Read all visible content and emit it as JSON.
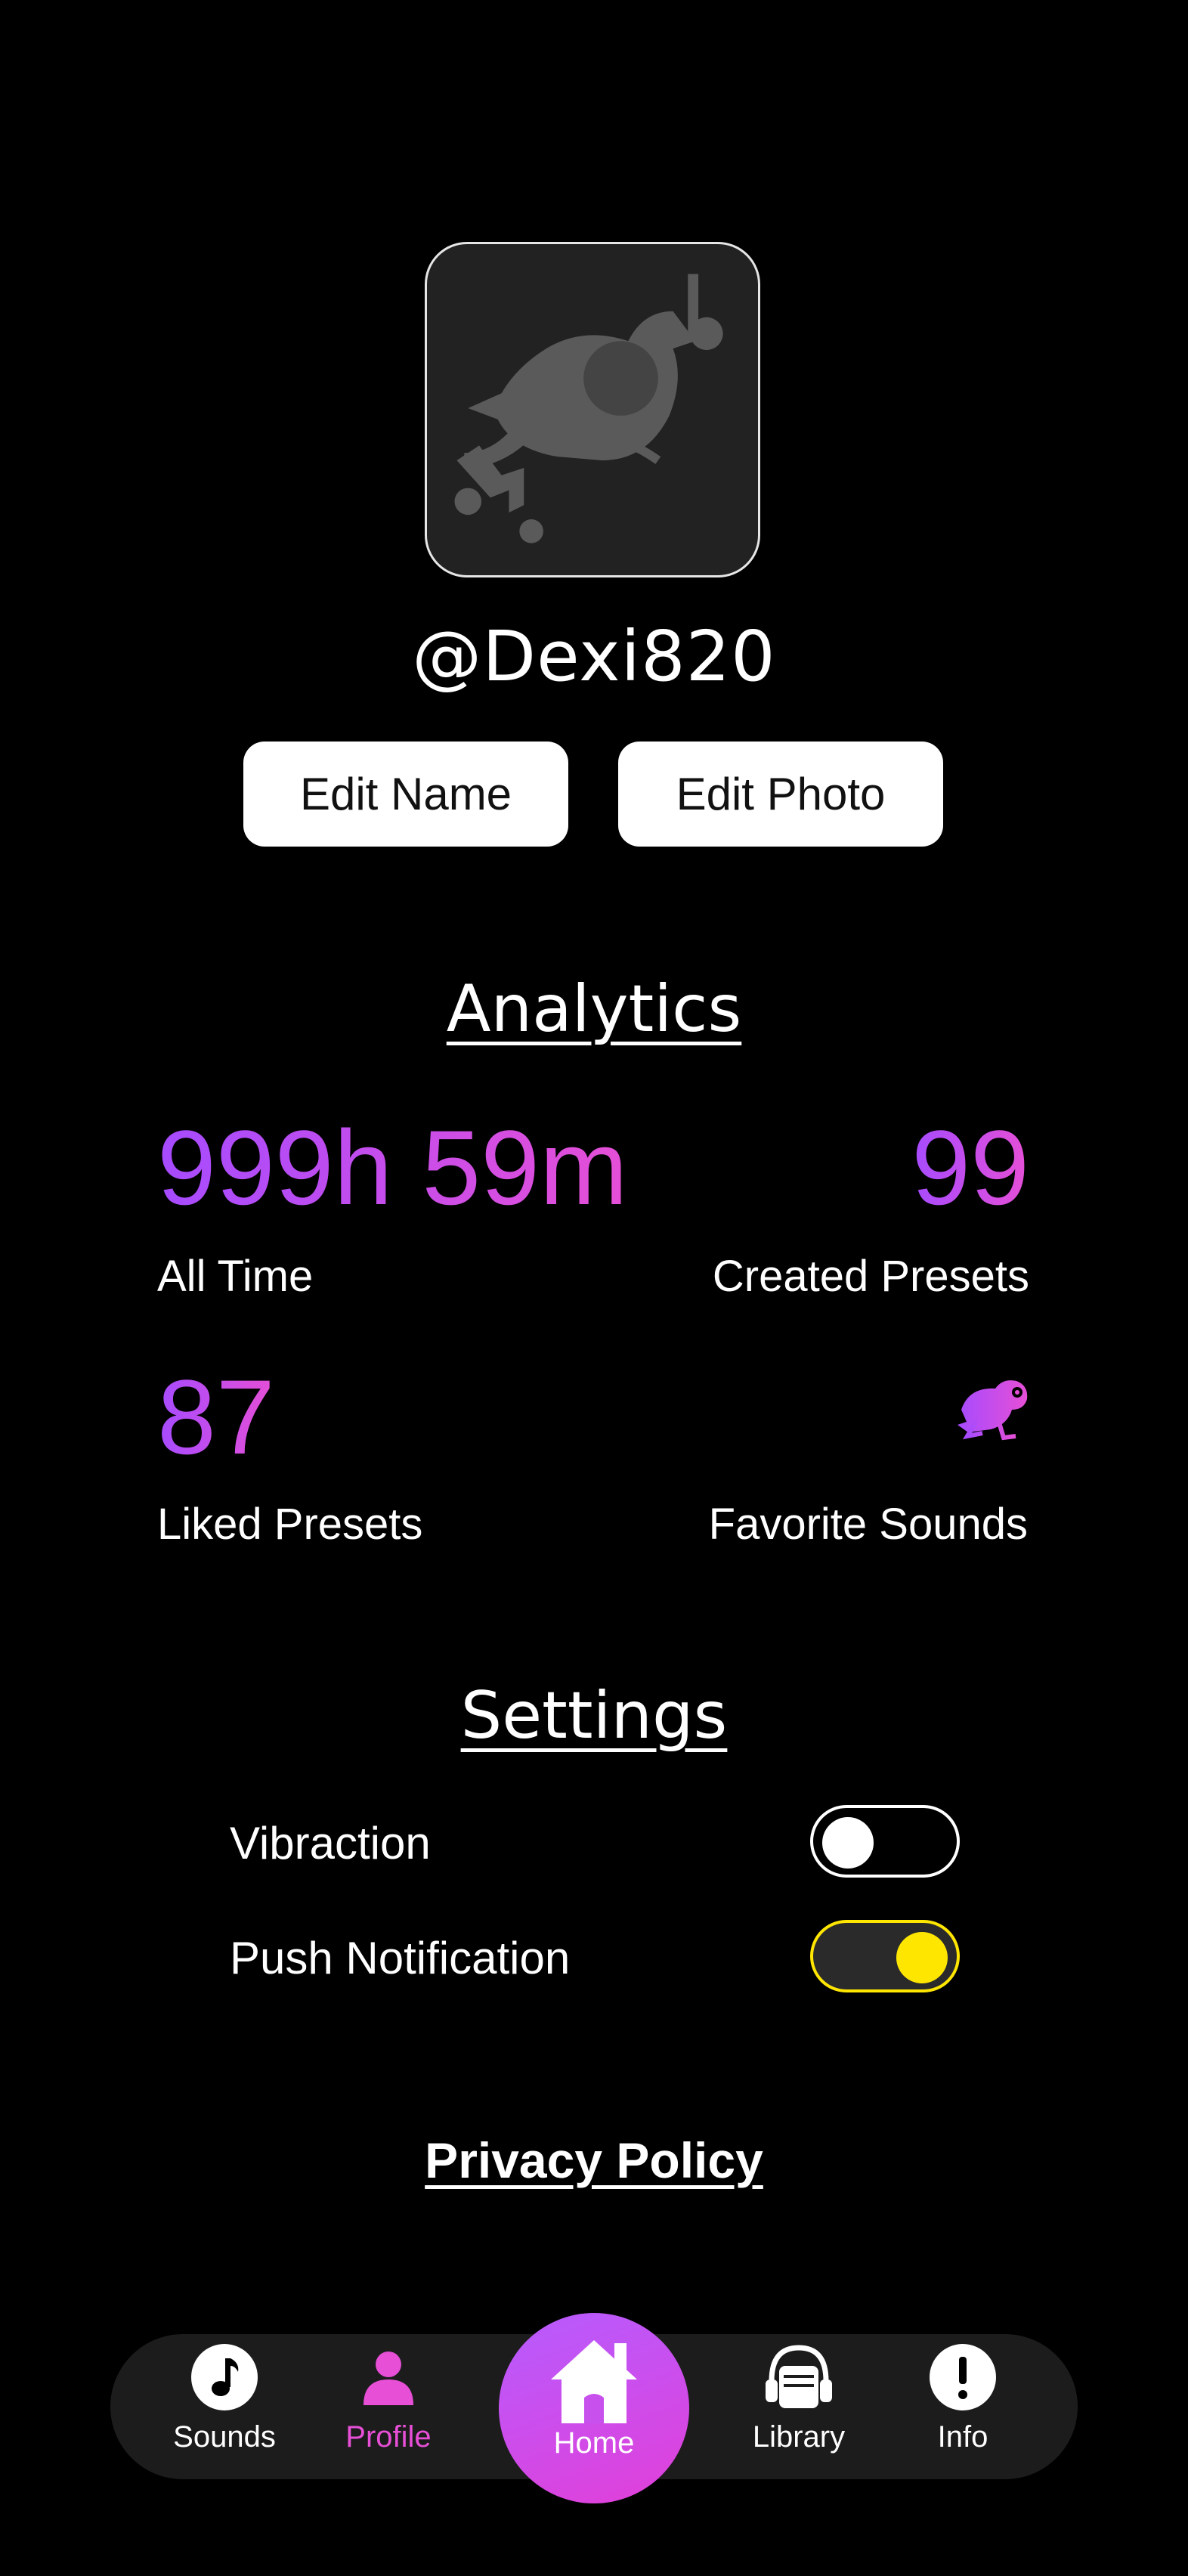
{
  "profile": {
    "username": "@Dexi820",
    "edit_name_label": "Edit Name",
    "edit_photo_label": "Edit Photo"
  },
  "analytics": {
    "title": "Analytics",
    "all_time_value": "999h 59m",
    "all_time_label": "All Time",
    "created_value": "99",
    "created_label": "Created Presets",
    "liked_value": "87",
    "liked_label": "Liked Presets",
    "favorite_icon": "frog-icon",
    "favorite_label": "Favorite Sounds"
  },
  "settings": {
    "title": "Settings",
    "vibration_label": "Vibraction",
    "vibration_on": false,
    "push_label": "Push Notification",
    "push_on": true
  },
  "footer": {
    "privacy_label": "Privacy Policy"
  },
  "nav": {
    "items": [
      {
        "label": "Sounds",
        "icon": "music-note-icon"
      },
      {
        "label": "Profile",
        "icon": "person-icon",
        "active": true
      },
      {
        "label": "Home",
        "icon": "home-icon"
      },
      {
        "label": "Library",
        "icon": "library-icon"
      },
      {
        "label": "Info",
        "icon": "info-icon"
      }
    ]
  },
  "colors": {
    "accent_purple": "#a64bff",
    "accent_pink": "#e64fd6",
    "toggle_yellow": "#ffe600"
  }
}
